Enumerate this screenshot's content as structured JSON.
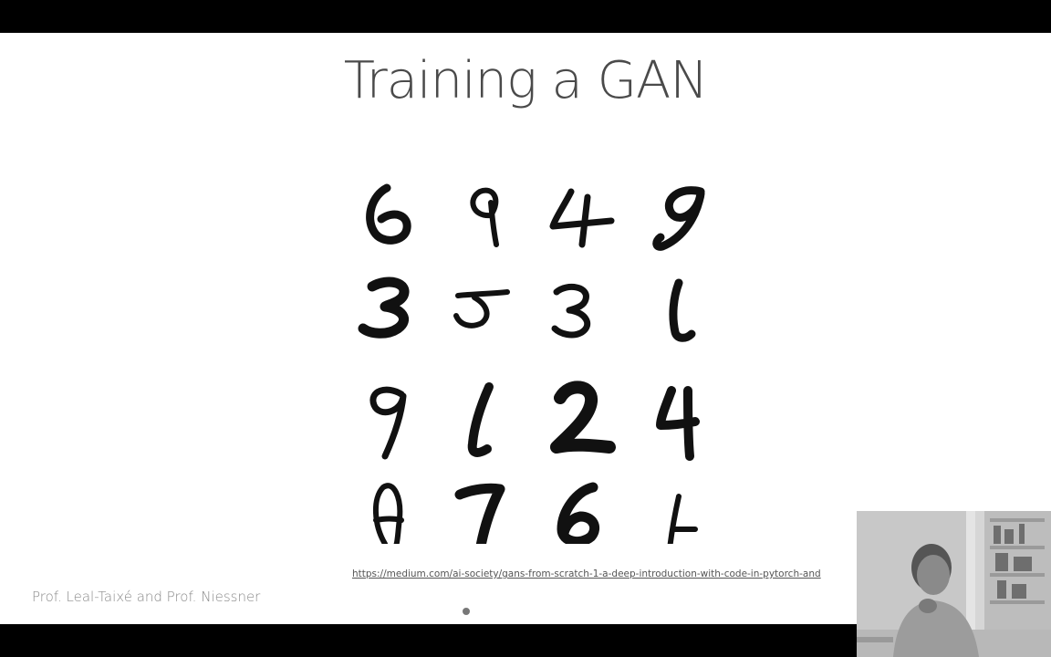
{
  "slide": {
    "title": "Training a GAN",
    "source_link": "https://medium.com/ai-society/gans-from-scratch-1-a-deep-introduction-with-code-in-pytorch-and",
    "footer": "Prof. Leal-Taixé and Prof. Niessner"
  },
  "figure": {
    "digit_grid": [
      [
        "6",
        "9",
        "4",
        "9"
      ],
      [
        "3",
        "5",
        "3",
        "1"
      ],
      [
        "9",
        "1",
        "2",
        "4"
      ],
      [
        "8",
        "7",
        "6",
        "1"
      ]
    ]
  },
  "colors": {
    "background": "#ffffff",
    "title": "#4a4a4a",
    "ink": "#111111",
    "letterbox": "#000000"
  }
}
